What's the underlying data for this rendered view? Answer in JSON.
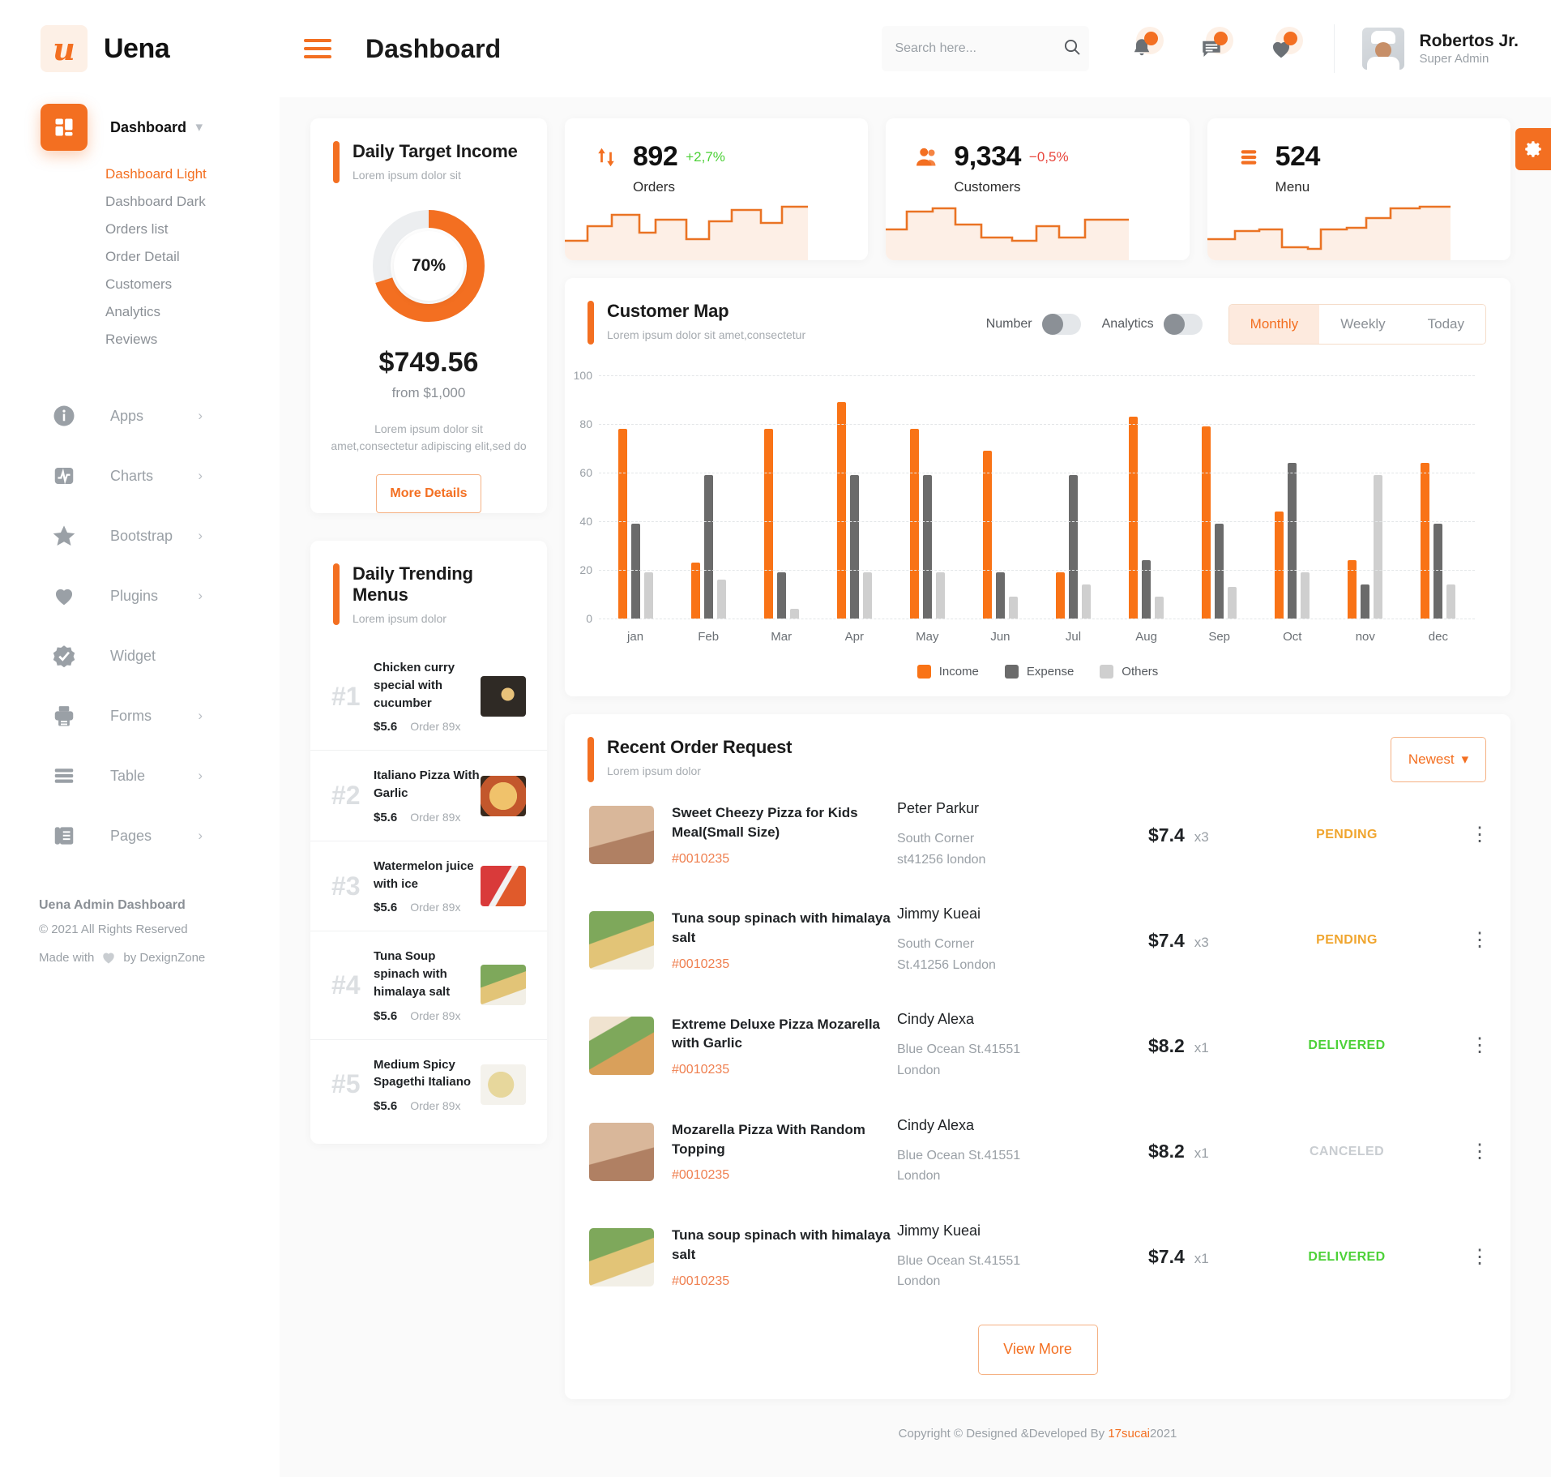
{
  "brand": {
    "logo_glyph": "u",
    "name": "Uena"
  },
  "header": {
    "title": "Dashboard",
    "search": {
      "placeholder": "Search here...",
      "value": ""
    },
    "profile": {
      "name": "Robertos Jr.",
      "role": "Super Admin"
    }
  },
  "sidebar": {
    "main_item": {
      "label": "Dashboard"
    },
    "sub_items": [
      {
        "label": "Dashboard Light",
        "active": true
      },
      {
        "label": "Dashboard Dark",
        "active": false
      },
      {
        "label": "Orders list",
        "active": false
      },
      {
        "label": "Order Detail",
        "active": false
      },
      {
        "label": "Customers",
        "active": false
      },
      {
        "label": "Analytics",
        "active": false
      },
      {
        "label": "Reviews",
        "active": false
      }
    ],
    "items": [
      {
        "label": "Apps",
        "icon": "info-icon"
      },
      {
        "label": "Charts",
        "icon": "chart-icon"
      },
      {
        "label": "Bootstrap",
        "icon": "star-icon"
      },
      {
        "label": "Plugins",
        "icon": "heart-icon"
      },
      {
        "label": "Widget",
        "icon": "widget-icon"
      },
      {
        "label": "Forms",
        "icon": "printer-icon"
      },
      {
        "label": "Table",
        "icon": "table-icon"
      },
      {
        "label": "Pages",
        "icon": "pages-icon"
      }
    ],
    "footer": {
      "title": "Uena Admin Dashboard",
      "copyright": "© 2021 All Rights Reserved",
      "made_prefix": "Made with",
      "made_suffix": "by DexignZone"
    }
  },
  "daily_target": {
    "title": "Daily Target Income",
    "subtitle": "Lorem ipsum dolor sit",
    "percent": "70%",
    "percent_value": 70,
    "amount": "$749.56",
    "from": "from $1,000",
    "description": "Lorem ipsum dolor sit amet,consectetur adipiscing elit,sed do",
    "button": "More Details"
  },
  "stats": [
    {
      "value": "892",
      "delta": "+2,7%",
      "delta_color": "#4cd137",
      "label": "Orders",
      "icon": "arrows-updown-icon"
    },
    {
      "value": "9,334",
      "delta": "−0,5%",
      "delta_color": "#e8453c",
      "label": "Customers",
      "icon": "users-icon"
    },
    {
      "value": "524",
      "delta": "",
      "delta_color": "",
      "label": "Menu",
      "icon": "menu-lines-icon"
    }
  ],
  "customer_map": {
    "title": "Customer Map",
    "subtitle": "Lorem ipsum dolor sit amet,consectetur",
    "toggles": [
      {
        "label": "Number",
        "on": false
      },
      {
        "label": "Analytics",
        "on": false
      }
    ],
    "segments": [
      {
        "label": "Monthly",
        "active": true
      },
      {
        "label": "Weekly",
        "active": false
      },
      {
        "label": "Today",
        "active": false
      }
    ]
  },
  "chart_data": {
    "type": "bar",
    "title": "Customer Map",
    "xlabel": "",
    "ylabel": "",
    "ylim": [
      0,
      100
    ],
    "yticks": [
      0,
      20,
      40,
      60,
      80,
      100
    ],
    "grid": true,
    "legend_position": "bottom",
    "categories": [
      "jan",
      "Feb",
      "Mar",
      "Apr",
      "May",
      "Jun",
      "Jul",
      "Aug",
      "Sep",
      "Oct",
      "nov",
      "dec"
    ],
    "series": [
      {
        "name": "Income",
        "color": "#f97316",
        "values": [
          78,
          23,
          78,
          89,
          78,
          69,
          19,
          83,
          79,
          44,
          24,
          64
        ]
      },
      {
        "name": "Expense",
        "color": "#6b6b6b",
        "values": [
          39,
          59,
          19,
          59,
          59,
          19,
          59,
          24,
          39,
          64,
          14,
          39
        ]
      },
      {
        "name": "Others",
        "color": "#cfcfcf",
        "values": [
          19,
          16,
          4,
          19,
          19,
          9,
          14,
          9,
          13,
          19,
          59,
          14
        ]
      }
    ]
  },
  "trending": {
    "title": "Daily Trending Menus",
    "subtitle": "Lorem ipsum dolor",
    "items": [
      {
        "rank": "#1",
        "name": "Chicken curry special with cucumber",
        "price": "$5.6",
        "orders": "Order 89x",
        "thumb": "f1"
      },
      {
        "rank": "#2",
        "name": "Italiano Pizza With Garlic",
        "price": "$5.6",
        "orders": "Order 89x",
        "thumb": "f2"
      },
      {
        "rank": "#3",
        "name": "Watermelon juice with ice",
        "price": "$5.6",
        "orders": "Order 89x",
        "thumb": "f3"
      },
      {
        "rank": "#4",
        "name": "Tuna Soup spinach with himalaya salt",
        "price": "$5.6",
        "orders": "Order 89x",
        "thumb": "f4"
      },
      {
        "rank": "#5",
        "name": "Medium Spicy Spagethi Italiano",
        "price": "$5.6",
        "orders": "Order 89x",
        "thumb": "f5"
      }
    ]
  },
  "orders": {
    "title": "Recent Order Request",
    "subtitle": "Lorem ipsum dolor",
    "sort_label": "Newest",
    "view_more": "View More",
    "rows": [
      {
        "thumb": "fface",
        "item": "Sweet Cheezy Pizza for Kids Meal(Small Size)",
        "id": "#0010235",
        "customer": "Peter Parkur",
        "addr1": "South Corner",
        "addr2": "st41256 london",
        "price": "$7.4",
        "qty": "x3",
        "status": "PENDING",
        "status_class": "st-pending"
      },
      {
        "thumb": "f4",
        "item": "Tuna soup spinach with himalaya salt",
        "id": "#0010235",
        "customer": "Jimmy Kueai",
        "addr1": "South Corner",
        "addr2": "St.41256 London",
        "price": "$7.4",
        "qty": "x3",
        "status": "PENDING",
        "status_class": "st-pending"
      },
      {
        "thumb": "f6",
        "item": "Extreme Deluxe Pizza Mozarella with Garlic",
        "id": "#0010235",
        "customer": "Cindy Alexa",
        "addr1": "Blue Ocean St.41551",
        "addr2": "London",
        "price": "$8.2",
        "qty": "x1",
        "status": "DELIVERED",
        "status_class": "st-delivered"
      },
      {
        "thumb": "fface",
        "item": "Mozarella Pizza With Random Topping",
        "id": "#0010235",
        "customer": "Cindy Alexa",
        "addr1": "Blue Ocean St.41551",
        "addr2": "London",
        "price": "$8.2",
        "qty": "x1",
        "status": "CANCELED",
        "status_class": "st-canceled"
      },
      {
        "thumb": "f4",
        "item": "Tuna soup spinach with himalaya salt",
        "id": "#0010235",
        "customer": "Jimmy Kueai",
        "addr1": "Blue Ocean St.41551",
        "addr2": "London",
        "price": "$7.4",
        "qty": "x1",
        "status": "DELIVERED",
        "status_class": "st-delivered"
      }
    ]
  },
  "footer": {
    "copyright_prefix": "Copyright © Designed &Developed By ",
    "link": "17sucai",
    "year": "2021"
  },
  "colors": {
    "accent": "#f36f21",
    "expense": "#6b6b6b",
    "others": "#cfcfcf",
    "success": "#4cd137",
    "danger": "#e8453c"
  }
}
